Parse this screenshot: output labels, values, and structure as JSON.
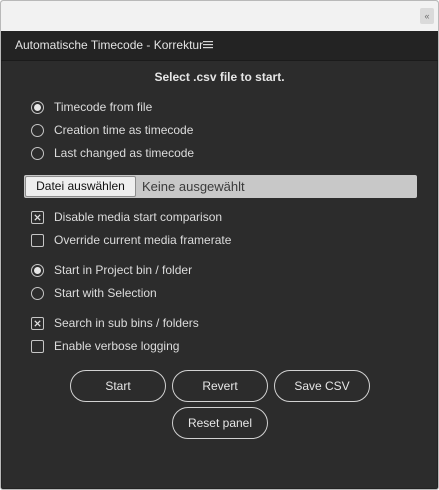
{
  "panel": {
    "title": "Automatische Timecode - Korrektur"
  },
  "heading": "Select .csv file to start.",
  "timecode_source": {
    "options": [
      {
        "label": "Timecode from file",
        "selected": true
      },
      {
        "label": "Creation time as timecode",
        "selected": false
      },
      {
        "label": "Last changed as timecode",
        "selected": false
      }
    ]
  },
  "file_picker": {
    "button_label": "Datei auswählen",
    "status": "Keine ausgewählt"
  },
  "media_options": [
    {
      "label": "Disable media start comparison",
      "checked": true
    },
    {
      "label": "Override current media framerate",
      "checked": false
    }
  ],
  "start_location": {
    "options": [
      {
        "label": "Start in Project bin / folder",
        "selected": true
      },
      {
        "label": "Start with Selection",
        "selected": false
      }
    ]
  },
  "search_options": [
    {
      "label": "Search in sub bins / folders",
      "checked": true
    },
    {
      "label": "Enable verbose logging",
      "checked": false
    }
  ],
  "buttons": {
    "start": "Start",
    "revert": "Revert",
    "save_csv": "Save CSV",
    "reset_panel": "Reset panel"
  },
  "icons": {
    "panel_menu": "hamburger-menu-icon",
    "collapse": "collapse-chevron-icon",
    "checkbox_check": "x-mark-icon"
  }
}
